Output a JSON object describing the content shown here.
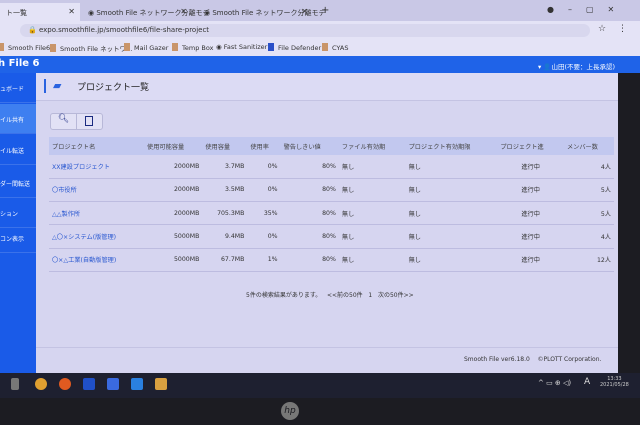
{
  "browser": {
    "tabs": [
      "ト一覧",
      "Smooth File ネットワーク分離モデ",
      "Smooth File ネットワーク分離モデ"
    ],
    "new_tab": "+",
    "url": "expo.smoothfile.jp/smoothfile6/file-share-project",
    "bookmarks": [
      "Smooth File6",
      "Smooth File ネットワ...",
      "Mail Gazer",
      "Temp Box",
      "Fast Sanitizer",
      "File Defender",
      "CYAS"
    ]
  },
  "app": {
    "logo": "h File 6",
    "user": "山田(不要：上長承認)"
  },
  "sidebar": {
    "items": [
      "ュボード",
      "イル共有",
      "イル転送",
      "ダー間転送",
      "ション",
      "コン表示"
    ]
  },
  "page": {
    "title": "プロジェクト一覧"
  },
  "table": {
    "headers": [
      "プロジェクト名",
      "使用可能容量",
      "使用容量",
      "使用率",
      "警告しきい値",
      "ファイル有効期",
      "プロジェクト有効期限",
      "プロジェクト進",
      "メンバー数"
    ],
    "rows": [
      [
        "XX建設プロジェクト",
        "2000MB",
        "3.7MB",
        "0%",
        "80%",
        "無し",
        "無し",
        "進行中",
        "4人"
      ],
      [
        "〇市役所",
        "2000MB",
        "3.5MB",
        "0%",
        "80%",
        "無し",
        "無し",
        "進行中",
        "5人"
      ],
      [
        "△△製作所",
        "2000MB",
        "705.3MB",
        "35%",
        "80%",
        "無し",
        "無し",
        "進行中",
        "5人"
      ],
      [
        "△〇×システム(版管理)",
        "5000MB",
        "9.4MB",
        "0%",
        "80%",
        "無し",
        "無し",
        "進行中",
        "4人"
      ],
      [
        "〇×△工業(自動版管理)",
        "5000MB",
        "67.7MB",
        "1%",
        "80%",
        "無し",
        "無し",
        "進行中",
        "12人"
      ]
    ]
  },
  "pagination": {
    "summary": "5件の検索結果があります。",
    "prev": "<<前の50件",
    "page": "1",
    "next": "次の50件>>"
  },
  "footer": {
    "version": "Smooth File ver6.18.0",
    "copyright": "©PLOTT Corporation."
  },
  "taskbar": {
    "time": "13:33",
    "date": "2021/05/28",
    "ime": "A"
  },
  "bezel": {
    "logo": "hp"
  }
}
